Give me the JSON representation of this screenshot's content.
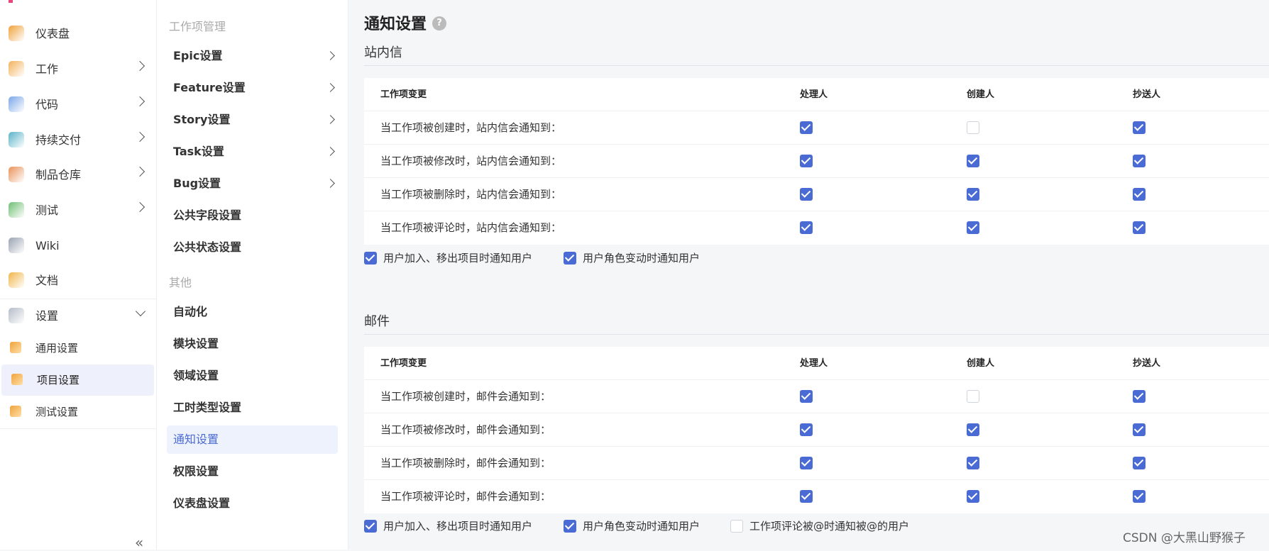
{
  "nav": {
    "items": [
      {
        "label": "仪表盘",
        "icon": "dashboard-icon",
        "color": "#f0a23a",
        "chev": ""
      },
      {
        "label": "工作",
        "icon": "work-icon",
        "color": "#f3b25a",
        "chev": "right"
      },
      {
        "label": "代码",
        "icon": "code-icon",
        "color": "#7aa7e8",
        "chev": "right"
      },
      {
        "label": "持续交付",
        "icon": "delivery-icon",
        "color": "#5ab3c8",
        "chev": "right"
      },
      {
        "label": "制品仓库",
        "icon": "artifact-icon",
        "color": "#e9925a",
        "chev": "right"
      },
      {
        "label": "测试",
        "icon": "test-icon",
        "color": "#6fbf73",
        "chev": "right"
      },
      {
        "label": "Wiki",
        "icon": "wiki-icon",
        "color": "#9aa3b2",
        "chev": ""
      },
      {
        "label": "文档",
        "icon": "docs-icon",
        "color": "#f0b64a",
        "chev": ""
      },
      {
        "label": "设置",
        "icon": "settings-icon",
        "color": "#b5bcc8",
        "chev": "down"
      }
    ],
    "subitems": [
      {
        "label": "通用设置",
        "icon": "general-settings-icon",
        "color": "#f0a23a",
        "active": false
      },
      {
        "label": "项目设置",
        "icon": "project-settings-icon",
        "color": "#f0a23a",
        "active": true
      },
      {
        "label": "测试设置",
        "icon": "test-settings-icon",
        "color": "#f0a23a",
        "active": false
      }
    ]
  },
  "subnav": {
    "group1": "工作项管理",
    "items1": [
      {
        "label": "Epic设置",
        "chev": true
      },
      {
        "label": "Feature设置",
        "chev": true
      },
      {
        "label": "Story设置",
        "chev": true
      },
      {
        "label": "Task设置",
        "chev": true
      },
      {
        "label": "Bug设置",
        "chev": true
      },
      {
        "label": "公共字段设置",
        "chev": false
      },
      {
        "label": "公共状态设置",
        "chev": false
      }
    ],
    "group2": "其他",
    "items2": [
      {
        "label": "自动化",
        "active": false
      },
      {
        "label": "模块设置",
        "active": false
      },
      {
        "label": "领域设置",
        "active": false
      },
      {
        "label": "工时类型设置",
        "active": false
      },
      {
        "label": "通知设置",
        "active": true
      },
      {
        "label": "权限设置",
        "active": false
      },
      {
        "label": "仪表盘设置",
        "active": false
      }
    ]
  },
  "main": {
    "title": "通知设置",
    "help": "?",
    "sections": [
      {
        "title": "站内信",
        "headers": [
          "工作项变更",
          "处理人",
          "创建人",
          "抄送人"
        ],
        "rows": [
          {
            "label": "当工作项被创建时，站内信会通知到：",
            "checks": [
              true,
              false,
              true
            ]
          },
          {
            "label": "当工作项被修改时，站内信会通知到：",
            "checks": [
              true,
              true,
              true
            ]
          },
          {
            "label": "当工作项被删除时，站内信会通知到：",
            "checks": [
              true,
              true,
              true
            ]
          },
          {
            "label": "当工作项被评论时，站内信会通知到：",
            "checks": [
              true,
              true,
              true
            ]
          }
        ],
        "options": [
          {
            "label": "用户加入、移出项目时通知用户",
            "checked": true
          },
          {
            "label": "用户角色变动时通知用户",
            "checked": true
          }
        ]
      },
      {
        "title": "邮件",
        "headers": [
          "工作项变更",
          "处理人",
          "创建人",
          "抄送人"
        ],
        "rows": [
          {
            "label": "当工作项被创建时，邮件会通知到：",
            "checks": [
              true,
              false,
              true
            ]
          },
          {
            "label": "当工作项被修改时，邮件会通知到：",
            "checks": [
              true,
              true,
              true
            ]
          },
          {
            "label": "当工作项被删除时，邮件会通知到：",
            "checks": [
              true,
              true,
              true
            ]
          },
          {
            "label": "当工作项被评论时，邮件会通知到：",
            "checks": [
              true,
              true,
              true
            ]
          }
        ],
        "options": [
          {
            "label": "用户加入、移出项目时通知用户",
            "checked": true
          },
          {
            "label": "用户角色变动时通知用户",
            "checked": true
          },
          {
            "label": "工作项评论被@时通知被@的用户",
            "checked": false
          }
        ]
      }
    ]
  },
  "collapse": "«",
  "watermark": "CSDN @大黑山野猴子",
  "accent": "#4a6bd3"
}
